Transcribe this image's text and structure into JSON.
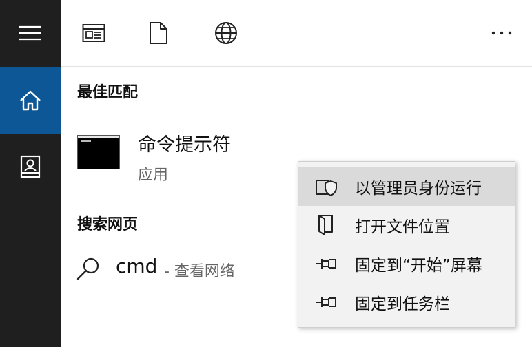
{
  "sidebar": {
    "items": [
      {
        "icon": "hamburger-menu-icon"
      },
      {
        "icon": "home-icon",
        "active": true
      },
      {
        "icon": "notebook-icon"
      }
    ],
    "active_color": "#0e5796"
  },
  "topbar": {
    "filters": [
      {
        "icon": "apps-filter-icon"
      },
      {
        "icon": "documents-filter-icon"
      },
      {
        "icon": "web-filter-icon"
      }
    ],
    "more_icon": "more-options-icon"
  },
  "best_match": {
    "title": "最佳匹配",
    "app_name": "命令提示符",
    "app_type": "应用",
    "app_icon": "cmd-terminal-icon"
  },
  "web_search": {
    "title": "搜索网页",
    "query": "cmd",
    "suffix": "- 查看网络",
    "icon": "search-icon"
  },
  "context_menu": {
    "items": [
      {
        "label": "以管理员身份运行",
        "icon": "shield-icon",
        "hovered": true
      },
      {
        "label": "打开文件位置",
        "icon": "open-folder-icon"
      },
      {
        "label": "固定到“开始”屏幕",
        "icon": "pin-icon"
      },
      {
        "label": "固定到任务栏",
        "icon": "pin-icon"
      }
    ]
  }
}
